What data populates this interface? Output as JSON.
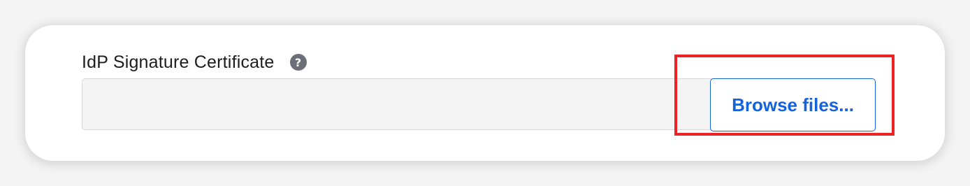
{
  "field": {
    "label": "IdP Signature Certificate",
    "help_icon": "question-circle-icon",
    "help_glyph": "?",
    "value": "",
    "browse_label": "Browse files..."
  },
  "colors": {
    "accent": "#1662dd",
    "highlight": "#ee2222",
    "label": "#1d1d21",
    "help_icon_bg": "#6e6e78",
    "field_bg": "#f4f4f4"
  }
}
